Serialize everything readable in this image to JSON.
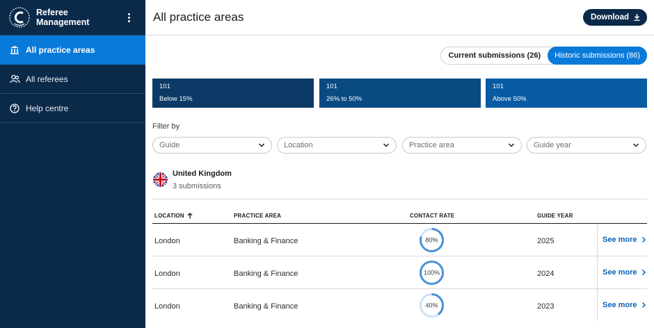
{
  "app": {
    "title": "Referee Management",
    "page_title": "All practice areas",
    "download_label": "Download"
  },
  "sidebar": {
    "items": [
      {
        "label": "All practice areas",
        "icon": "bank-icon",
        "active": true
      },
      {
        "label": "All referees",
        "icon": "users-icon",
        "active": false
      },
      {
        "label": "Help centre",
        "icon": "help-icon",
        "active": false
      }
    ]
  },
  "toggle": {
    "current": "Current submissions (26)",
    "historic": "Historic submissions (86)"
  },
  "stats": [
    {
      "count": "101",
      "label": "Below 15%",
      "color": "#0b3a66"
    },
    {
      "count": "101",
      "label": "26% to 50%",
      "color": "#0a4a82"
    },
    {
      "count": "101",
      "label": "Above 50%",
      "color": "#085ba3"
    }
  ],
  "filters": {
    "label": "Filter by",
    "options": [
      {
        "placeholder": "Guide"
      },
      {
        "placeholder": "Location"
      },
      {
        "placeholder": "Practice area"
      },
      {
        "placeholder": "Guide year"
      }
    ]
  },
  "country": {
    "name": "United Kingdom",
    "submissions": "3 submissions"
  },
  "table": {
    "headers": {
      "location": "LOCATION",
      "practice_area": "PRACTICE AREA",
      "contact_rate": "CONTACT RATE",
      "guide_year": "GUIDE YEAR"
    },
    "rows": [
      {
        "location": "London",
        "practice_area": "Banking & Finance",
        "contact_rate": "80%",
        "rate": 80,
        "guide_year": "2025",
        "action": "See more"
      },
      {
        "location": "London",
        "practice_area": "Banking & Finance",
        "contact_rate": "100%",
        "rate": 100,
        "guide_year": "2024",
        "action": "See more"
      },
      {
        "location": "London",
        "practice_area": "Banking & Finance",
        "contact_rate": "40%",
        "rate": 40,
        "guide_year": "2023",
        "action": "See more"
      }
    ]
  },
  "colors": {
    "sidebar_bg": "#0b2a4a",
    "accent": "#0a7ad9",
    "link": "#0a63b8",
    "ring_fill": "#4a90d9",
    "ring_track": "#cfe2f5"
  }
}
